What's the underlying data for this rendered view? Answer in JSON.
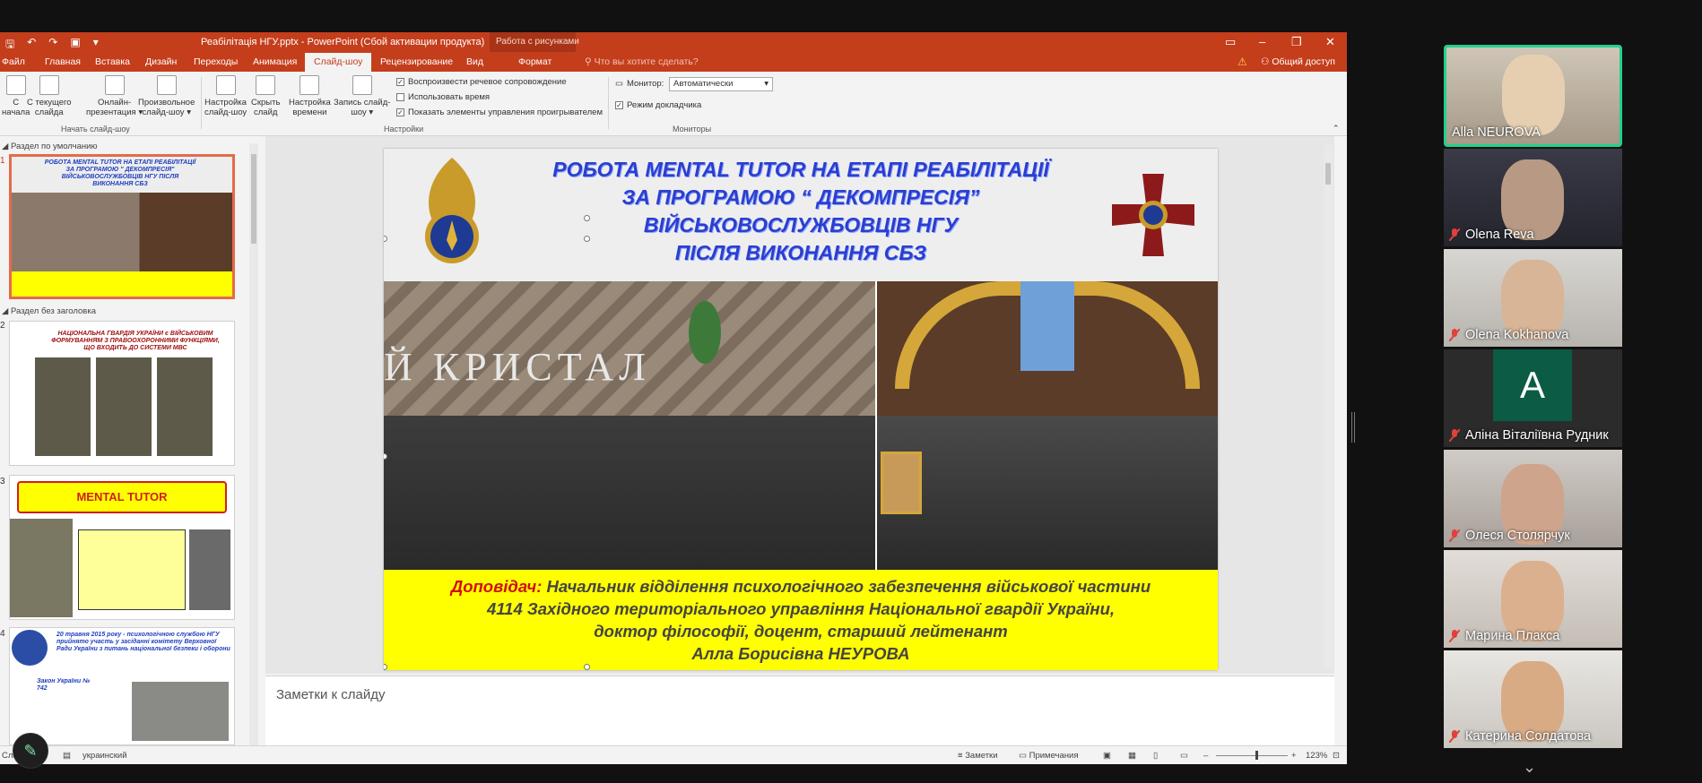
{
  "ppt": {
    "doc_title": "Реабілітація НГУ.pptx - PowerPoint (Сбой активации продукта)",
    "contextual_title": "Работа с рисунками",
    "tabs": [
      "Файл",
      "Главная",
      "Вставка",
      "Дизайн",
      "Переходы",
      "Анимация",
      "Слайд-шоу",
      "Рецензирование",
      "Вид",
      "Формат"
    ],
    "search_placeholder": "Что вы хотите сделать?",
    "share": "Общий доступ",
    "ribbon": {
      "from_start_1": "С",
      "from_start_2": "начала",
      "from_current_1": "С текущего",
      "from_current_2": "слайда",
      "online_1": "Онлайн-",
      "online_2": "презентация ▾",
      "custom_1": "Произвольное",
      "custom_2": "слайд-шоу ▾",
      "setup_1": "Настройка",
      "setup_2": "слайд-шоу",
      "hide_1": "Скрыть",
      "hide_2": "слайд",
      "timing_1": "Настройка",
      "timing_2": "времени",
      "record_1": "Запись слайд-",
      "record_2": "шоу ▾",
      "group_start": "Начать слайд-шоу",
      "group_settings": "Настройки",
      "group_monitors": "Мониторы",
      "chk_narration": "Воспроизвести речевое сопровождение",
      "chk_timings": "Использовать время",
      "chk_controls": "Показать элементы управления проигрывателем",
      "monitor_label": "Монитор:",
      "monitor_value": "Автоматически",
      "presenter_view": "Режим докладчика"
    },
    "thumbs": {
      "section_default": "Раздел по умолчанию",
      "section_untitled": "Раздел без заголовка",
      "slide1_title": "РОБОТА MENTAL TUTOR НА ЕТАПІ РЕАБІЛІТАЦІЇ ЗА ПРОГРАМОЮ \" ДЕКОМПРЕСІЯ\" ВІЙСЬКОВОСЛУЖБОВЦІВ НГУ ПІСЛЯ ВИКОНАННЯ СБЗ",
      "slide2_title": "НАЦІОНАЛЬНА ГВАРДІЯ УКРАЇНИ є ВІЙСЬКОВИМ ФОРМУВАННЯМ З ПРАВООХОРОННИМИ ФУНКЦІЯМИ, ЩО ВХОДИТЬ ДО СИСТЕМИ МВС",
      "slide3_title": "MENTAL TUTOR",
      "slide4_text": "20 травня 2015 року - психологічною службою НГУ прийнято участь у засіданні комітету Верховної Ради України з питань національної безпеки і оборони",
      "slide4_law": "Закон України № 742",
      "numbers": [
        "1",
        "2",
        "3",
        "4"
      ]
    },
    "slide": {
      "title_lines": [
        "РОБОТА MENTAL TUTOR НА ЕТАПІ РЕАБІЛІТАЦІЇ",
        "ЗА ПРОГРАМОЮ “ ДЕКОМПРЕСІЯ”",
        "ВІЙСЬКОВОСЛУЖБОВЦІВ НГУ",
        "ПІСЛЯ ВИКОНАННЯ СБЗ"
      ],
      "speaker_label": "Доповідач:",
      "caption_line1": " Начальник відділення психологічного забезпечення військової частини",
      "caption_line2": "4114 Західного територіального управління Національної гвардії України,",
      "caption_line3": "доктор філософії, доцент, старший лейтенант",
      "caption_line4": "Алла Борисівна НЕУРОВА",
      "sign_text": "Й КРИСТАЛ"
    },
    "notes_placeholder": "Заметки к слайду",
    "status": {
      "slide": "Слайд",
      "language": "украинский",
      "notes": "Заметки",
      "comments": "Примечания",
      "zoom": "123%"
    }
  },
  "participants": [
    {
      "name": "Alla NEUROVA",
      "muted": false,
      "active": true
    },
    {
      "name": "Olena Reva",
      "muted": true,
      "active": false
    },
    {
      "name": "Olena Kokhanova",
      "muted": true,
      "active": false
    },
    {
      "name": "Аліна Віталіївна Рудник",
      "muted": true,
      "active": false,
      "avatar_letter": "A"
    },
    {
      "name": "Олеся Столярчук",
      "muted": true,
      "active": false
    },
    {
      "name": "Марина Плакса",
      "muted": true,
      "active": false
    },
    {
      "name": "Катерина Солдатова",
      "muted": true,
      "active": false
    }
  ],
  "colors": {
    "ppt_accent": "#c43e1c",
    "active_speaker": "#23d18b",
    "muted_mic": "#e0413a",
    "title_blue": "#2a3fd0",
    "caption_yellow": "#ffff00"
  }
}
